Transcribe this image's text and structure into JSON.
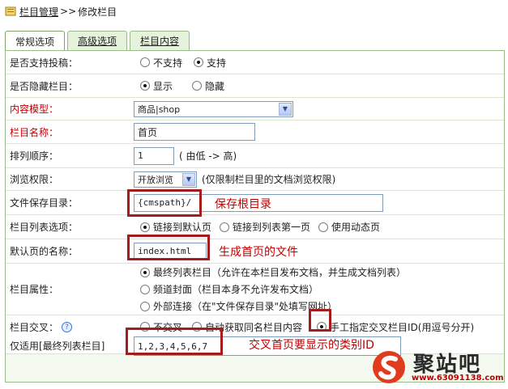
{
  "breadcrumb": {
    "root": "栏目管理",
    "separator": ">>",
    "current": "修改栏目"
  },
  "tabs": [
    {
      "label": "常规选项",
      "active": true
    },
    {
      "label": "高级选项",
      "active": false
    },
    {
      "label": "栏目内容",
      "active": false
    }
  ],
  "rows": {
    "contribute": {
      "label": "是否支持投稿：",
      "options": [
        "不支持",
        "支持"
      ],
      "selected": 1
    },
    "hidden": {
      "label": "是否隐藏栏目：",
      "options": [
        "显示",
        "隐藏"
      ],
      "selected": 0
    },
    "model": {
      "label": "内容模型：",
      "value": "商品|shop"
    },
    "name": {
      "label": "栏目名称：",
      "value": "首页"
    },
    "order": {
      "label": "排列顺序：",
      "value": "1",
      "hint": "( 由低 -> 高)"
    },
    "permission": {
      "label": "浏览权限：",
      "value": "开放浏览",
      "hint": "(仅限制栏目里的文档浏览权限)"
    },
    "save_dir": {
      "label": "文件保存目录：",
      "value": "{cmspath}/"
    },
    "list_option": {
      "label": "栏目列表选项：",
      "options": [
        "链接到默认页",
        "链接到列表第一页",
        "使用动态页"
      ],
      "selected": 0
    },
    "default_page": {
      "label": "默认页的名称：",
      "value": "index.html"
    },
    "attribute": {
      "label": "栏目属性：",
      "options": [
        "最终列表栏目（允许在本栏目发布文档，并生成文档列表）",
        "频道封面（栏目本身不允许发布文档）",
        "外部连接（在\"文件保存目录\"处填写网址）"
      ],
      "selected": 0
    },
    "cross": {
      "label": "栏目交叉：",
      "help": "?",
      "options": [
        "不交叉",
        "自动获取同名栏目内容",
        "手工指定交叉栏目ID(用逗号分开)"
      ],
      "selected": 2
    },
    "cross_ids": {
      "label": "仅适用[最终列表栏目]",
      "value": "1,2,3,4,5,6,7"
    }
  },
  "annotations": {
    "save_dir": "保存根目录",
    "default_page": "生成首页的文件",
    "cross_ids": "交叉首页要显示的类别ID"
  },
  "watermark": {
    "brand": "聚站吧",
    "url": "www.63091138.com"
  },
  "colors": {
    "highlight_box": "#a31d1d",
    "annotation_text": "#c00000",
    "tab_bg": "#e6f3dc",
    "border": "#9cb98a"
  }
}
